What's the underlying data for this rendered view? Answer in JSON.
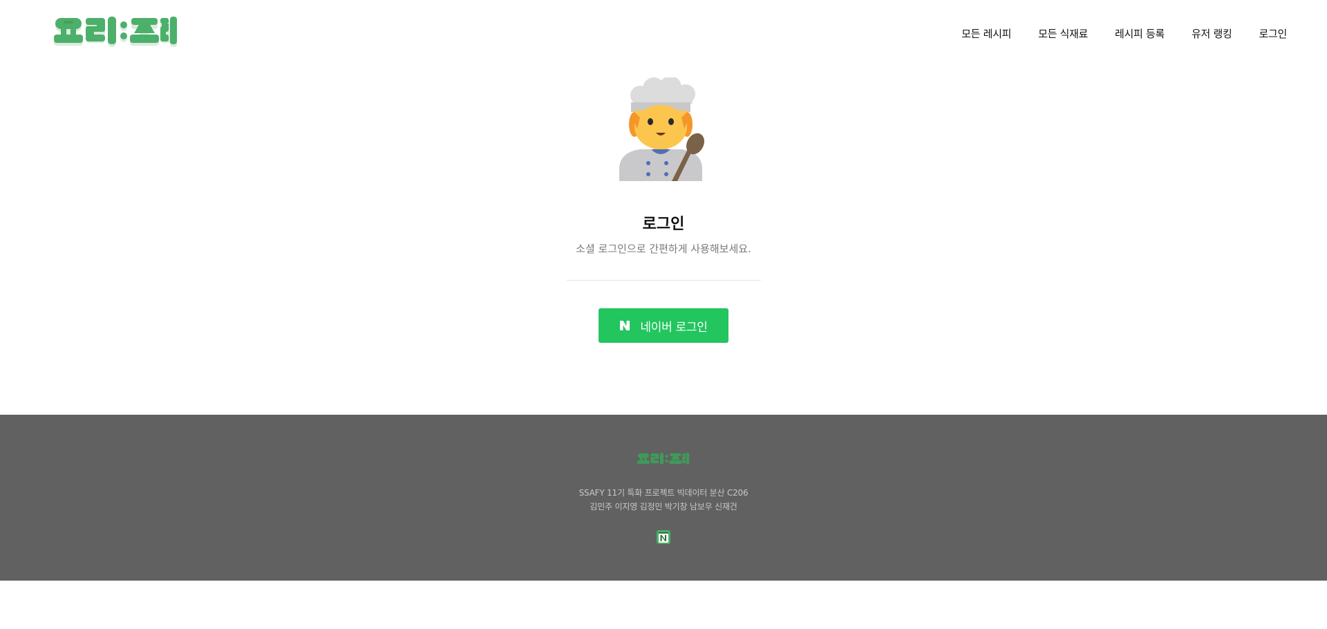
{
  "header": {
    "logo_text": "요리:조리",
    "nav": [
      {
        "label": "모든 레시피"
      },
      {
        "label": "모든 식재료"
      },
      {
        "label": "레시피 등록"
      },
      {
        "label": "유저 랭킹"
      },
      {
        "label": "로그인"
      }
    ]
  },
  "main": {
    "illustration": "chef-icon",
    "title": "로그인",
    "subtitle": "소셜 로그인으로 간편하게 사용해보세요.",
    "naver_button": {
      "icon": "naver-n-icon",
      "label": "네이버 로그인"
    }
  },
  "footer": {
    "logo_text": "요리:조리",
    "line1": "SSAFY 11기 특화 프로젝트 빅데이터 분산 C206",
    "line2": "김민주 이지영 김정민 박기창 남보우 신재건",
    "link_icon": "notion-icon"
  },
  "colors": {
    "brand_green": "#4caf6a",
    "button_green": "#22c55e",
    "footer_bg": "#616161",
    "footer_text": "#c9c9c9"
  }
}
